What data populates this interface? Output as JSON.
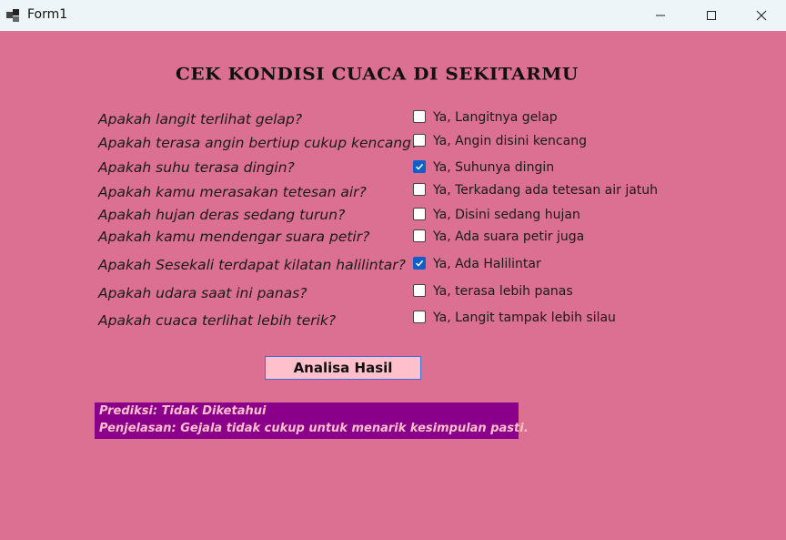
{
  "window": {
    "title": "Form1"
  },
  "heading": "CEK KONDISI CUACA DI SEKITARMU",
  "rows": [
    {
      "question": "Apakah langit terlihat gelap?",
      "option": "Ya, Langitnya gelap",
      "checked": false
    },
    {
      "question": "Apakah terasa angin bertiup cukup kencang?",
      "option": "Ya, Angin disini kencang",
      "checked": false
    },
    {
      "question": "Apakah suhu terasa dingin?",
      "option": "Ya, Suhunya dingin",
      "checked": true
    },
    {
      "question": "Apakah kamu merasakan tetesan air?",
      "option": "Ya, Terkadang ada tetesan air jatuh",
      "checked": false
    },
    {
      "question": "Apakah hujan deras sedang turun?",
      "option": "Ya, Disini sedang hujan",
      "checked": false
    },
    {
      "question": "Apakah kamu mendengar suara petir?",
      "option": "Ya, Ada suara petir juga",
      "checked": false
    },
    {
      "question": "Apakah Sesekali terdapat kilatan halilintar?",
      "option": "Ya, Ada Halilintar",
      "checked": true
    },
    {
      "question": "Apakah udara saat ini panas?",
      "option": "Ya, terasa lebih panas",
      "checked": false
    },
    {
      "question": "Apakah cuaca terlihat lebih terik?",
      "option": "Ya, Langit tampak lebih silau",
      "checked": false
    }
  ],
  "button": {
    "label": "Analisa Hasil"
  },
  "result": {
    "prediction": "Prediksi: Tidak Diketahui",
    "explanation": "Penjelasan: Gejala tidak cukup untuk menarik kesimpulan pasti."
  },
  "colors": {
    "background": "#db7093",
    "button": "#ffc0cb",
    "result_bg": "#8b008b",
    "result_text": "#ffc0cb",
    "checkbox_checked": "#0f5fc7"
  },
  "icons": {
    "app": "app-icon",
    "minimize": "minimize-icon",
    "maximize": "maximize-icon",
    "close": "close-icon"
  }
}
